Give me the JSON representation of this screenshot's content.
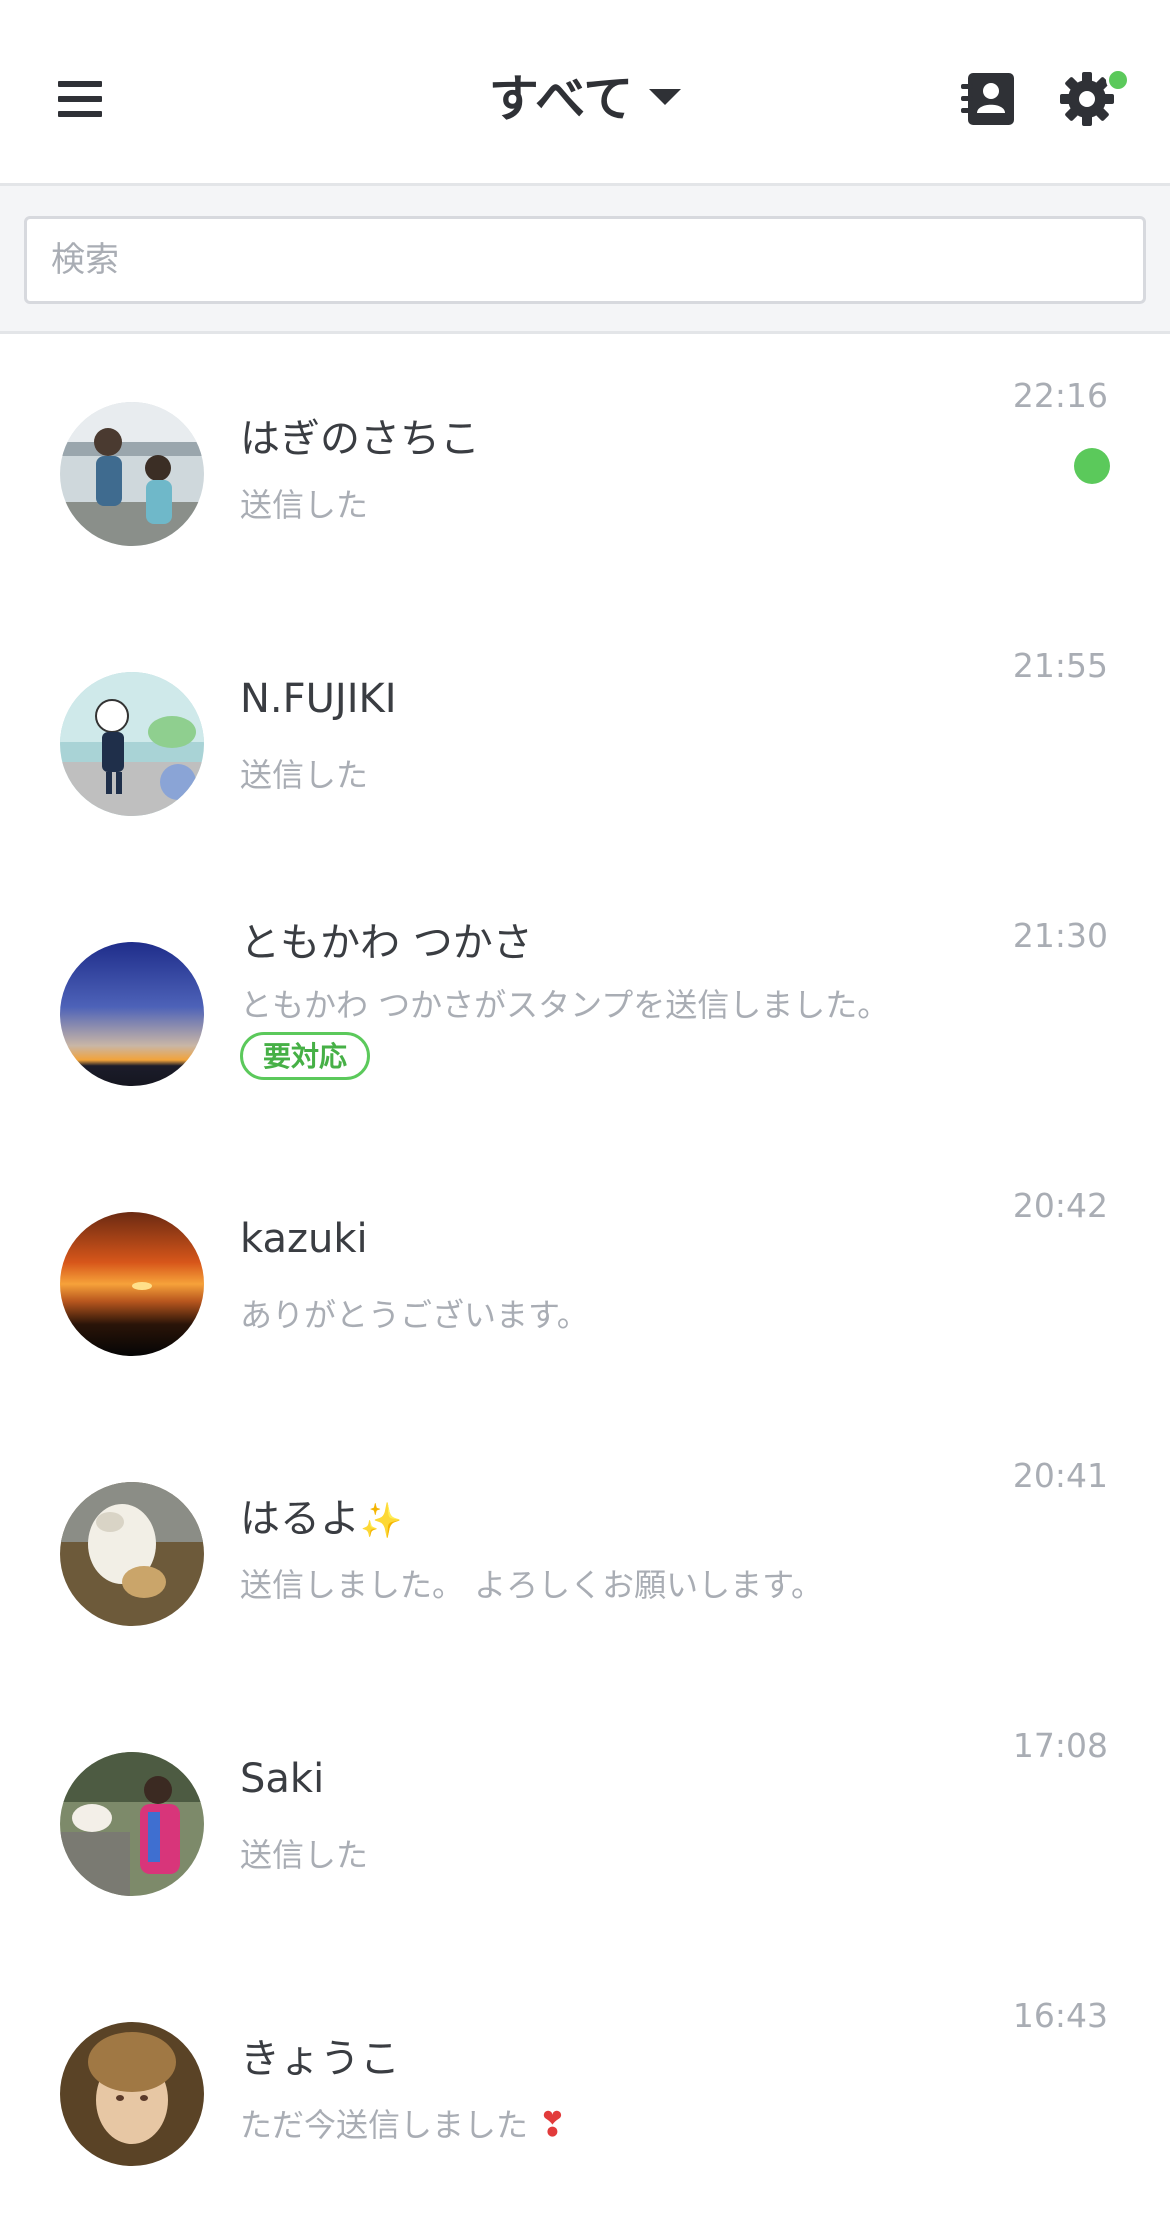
{
  "header": {
    "title": "すべて",
    "menu_icon": "hamburger-menu-icon",
    "contacts_icon": "contact-book-icon",
    "settings_icon": "gear-icon",
    "settings_badge_color": "#5bc95b"
  },
  "search": {
    "placeholder": "検索",
    "value": ""
  },
  "chats": [
    {
      "name": "はぎのさちこ",
      "message": "送信した",
      "time": "22:16",
      "unread": true
    },
    {
      "name": "N.FUJIKI",
      "message": "送信した",
      "time": "21:55",
      "unread": false
    },
    {
      "name": "ともかわ つかさ",
      "message": "ともかわ つかさがスタンプを送信しました。",
      "time": "21:30",
      "unread": false,
      "tag": "要対応"
    },
    {
      "name": "kazuki",
      "message": "ありがとうございます。",
      "time": "20:42",
      "unread": false
    },
    {
      "name": "はるよ",
      "name_emoji": "✨",
      "message": "送信しました。 よろしくお願いします。",
      "time": "20:41",
      "unread": false
    },
    {
      "name": "Saki",
      "message": "送信した",
      "time": "17:08",
      "unread": false
    },
    {
      "name": "きょうこ",
      "message": "ただ今送信しました",
      "message_emoji": "❣",
      "time": "16:43",
      "unread": false
    }
  ],
  "colors": {
    "accent": "#5bc95b",
    "text_primary": "#3a3d42",
    "text_secondary": "#a9adb4"
  }
}
